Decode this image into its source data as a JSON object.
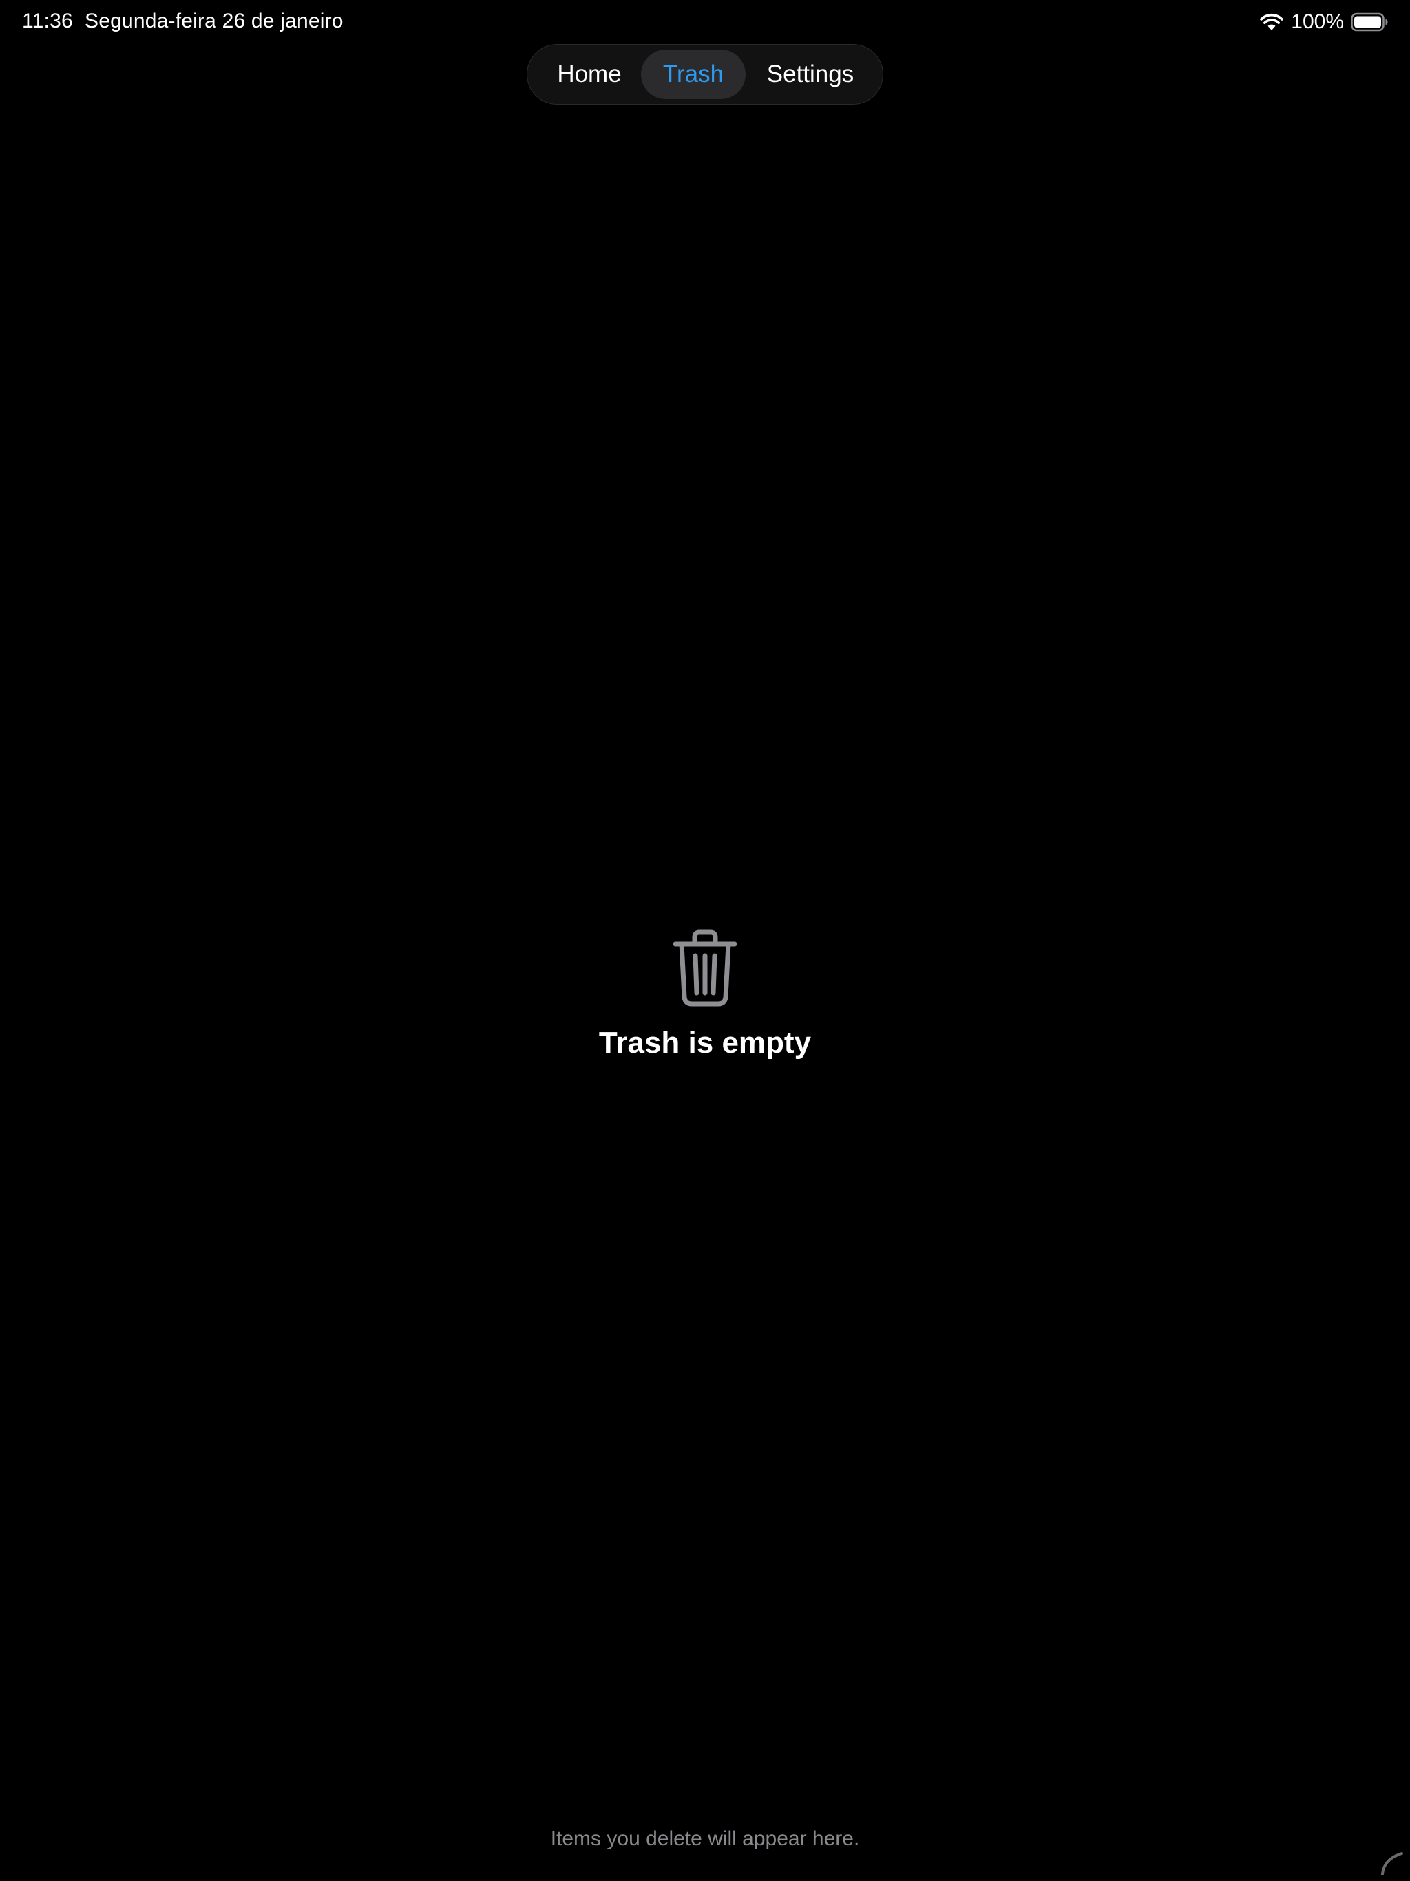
{
  "status_bar": {
    "time": "11:36",
    "date": "Segunda-feira 26 de janeiro",
    "battery_percent": "100%",
    "icons": [
      "wifi-icon",
      "battery-icon"
    ]
  },
  "tabs": [
    {
      "label": "Home",
      "selected": false
    },
    {
      "label": "Trash",
      "selected": true
    },
    {
      "label": "Settings",
      "selected": false
    }
  ],
  "empty_state": {
    "icon": "trash-icon",
    "title": "Trash is empty",
    "subtitle": "Items you delete will appear here."
  },
  "colors": {
    "background": "#000000",
    "accent": "#2f9bf0",
    "tab_bar": "#121212",
    "selected_tab": "#2b2b2d",
    "icon_gray": "#8e8e93",
    "secondary_text": "#8a8a8e"
  }
}
